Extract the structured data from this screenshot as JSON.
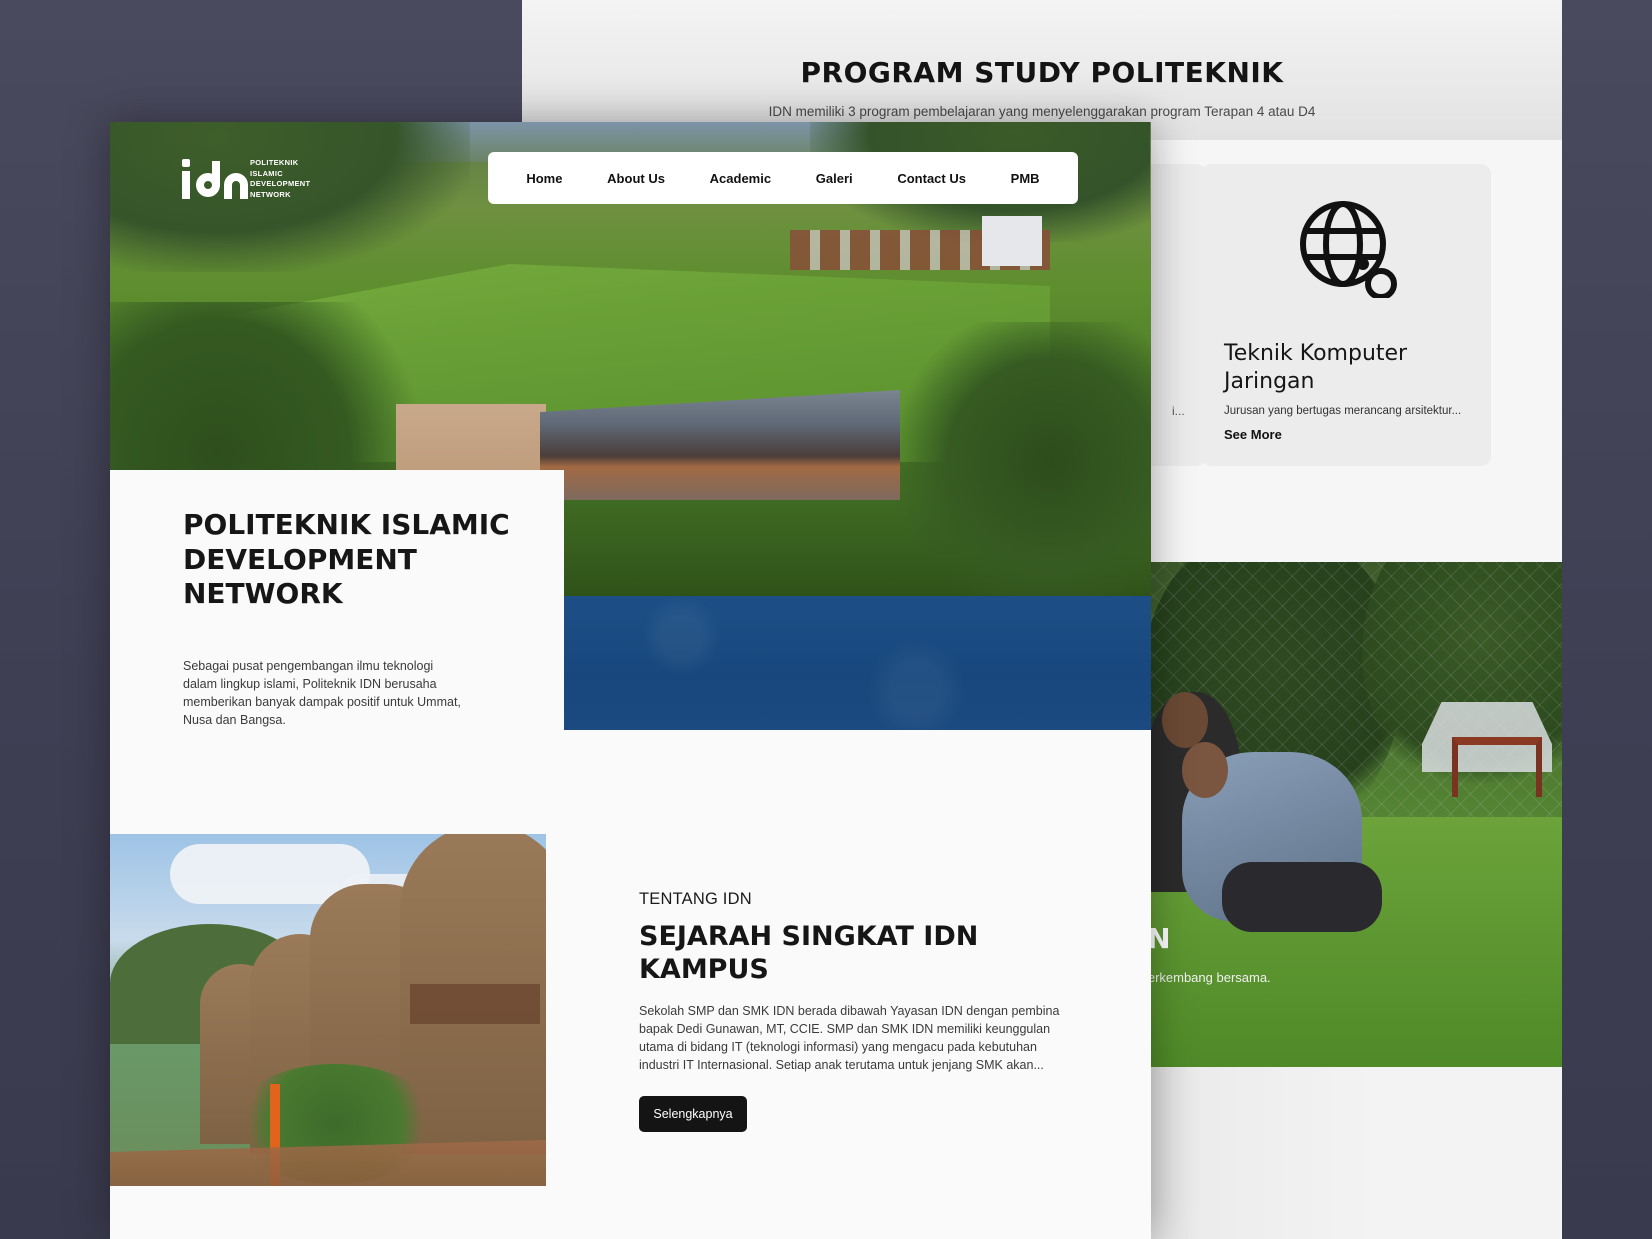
{
  "back_page": {
    "title": "PROGRAM STUDY POLITEKNIK",
    "subtitle": "IDN memiliki 3 program pembelajaran yang menyelenggarakan program Terapan 4 atau D4",
    "partial_card": {
      "desc_tail": "i..."
    },
    "card": {
      "icon": "globe-network-icon",
      "title": "Teknik Komputer Jaringan",
      "desc": "Jurusan yang bertugas merancang arsitektur...",
      "more": "See More"
    },
    "photo": {
      "heading": "A IDN",
      "sub": "buh dan berkembang bersama."
    }
  },
  "front_page": {
    "logo": {
      "mark": "idn",
      "lines": [
        "POLITEKNIK",
        "ISLAMIC",
        "DEVELOPMENT",
        "NETWORK"
      ]
    },
    "nav": [
      "Home",
      "About Us",
      "Academic",
      "Galeri",
      "Contact Us",
      "PMB"
    ],
    "hero": {
      "title": "POLITEKNIK ISLAMIC DEVELOPMENT NETWORK",
      "desc": "Sebagai pusat pengembangan ilmu teknologi dalam lingkup islami, Politeknik IDN berusaha memberikan banyak dampak positif untuk Ummat, Nusa dan Bangsa."
    },
    "about": {
      "kicker": "TENTANG IDN",
      "title": "SEJARAH SINGKAT IDN KAMPUS",
      "desc": "Sekolah SMP dan SMK IDN berada dibawah Yayasan IDN dengan pembina bapak Dedi Gunawan, MT, CCIE. SMP dan SMK IDN memiliki keunggulan utama di bidang IT (teknologi informasi) yang mengacu pada kebutuhan industri IT Internasional. Setiap anak terutama untuk jenjang SMK akan...",
      "button": "Selengkapnya"
    }
  },
  "colors": {
    "background": "#44445a",
    "dark": "#141414",
    "blue_band": "#1b4a80",
    "card_bg": "#ececed"
  }
}
